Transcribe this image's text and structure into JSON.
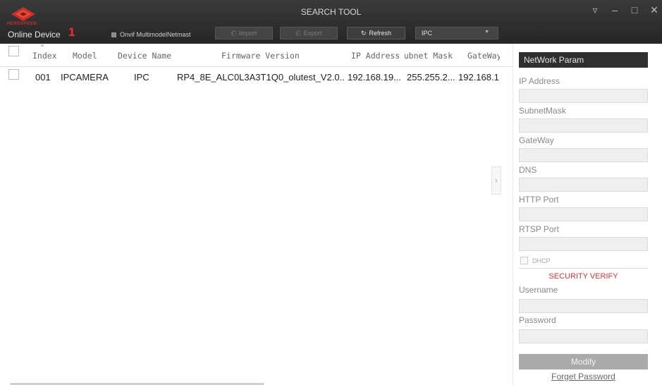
{
  "window": {
    "title": "SEARCH TOOL",
    "brand": "HEROSPEED",
    "controls": [
      "▿",
      "–",
      "□",
      "✕"
    ]
  },
  "toolbar": {
    "online_label": "Online Device",
    "online_count": "1",
    "onvif_label": "Onvif MultimodelNetmast",
    "import_label": "Import",
    "export_label": "Export",
    "refresh_label": "Refresh",
    "type_selected": "IPC"
  },
  "table": {
    "columns": [
      "Index",
      "Model",
      "Device Name",
      "Firmware Version",
      "IP Address",
      "Subnet Mask",
      "GateWay"
    ],
    "rows": [
      {
        "index": "001",
        "model": "IPCAMERA",
        "device_name": "IPC",
        "firmware": "RP4_8E_ALC0L3A3T1Q0_olutest_V2.0....",
        "ip": "192.168.19...",
        "subnet": "255.255.2...",
        "gateway": "192.168.1"
      }
    ]
  },
  "panel": {
    "title": "NetWork Param",
    "fields": {
      "ip": "IP Address",
      "subnet": "SubnetMask",
      "gateway": "GateWay",
      "dns": "DNS",
      "http": "HTTP Port",
      "rtsp": "RTSP Port"
    },
    "dhcp_label": "DHCP",
    "security_title": "SECURITY VERIFY",
    "username_label": "Username",
    "password_label": "Password",
    "modify_label": "Modify",
    "forget_label": "Forget Password"
  },
  "colors": {
    "titlebar": "#2e2e2e",
    "accent_red": "#e03030",
    "panel_header": "#2f2f2f"
  }
}
